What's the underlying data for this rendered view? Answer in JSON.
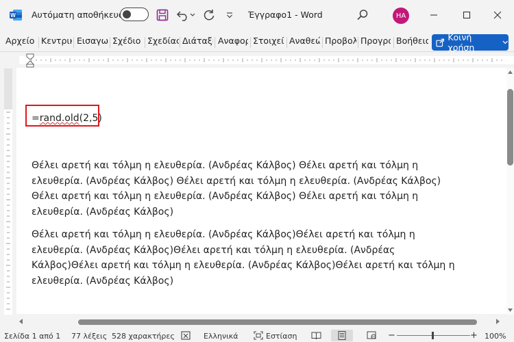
{
  "titlebar": {
    "autosave_label": "Αυτόματη αποθήκευση",
    "doc_title": "Έγγραφο1 - Word",
    "avatar_initials": "HA"
  },
  "ribbon": {
    "tabs": [
      "Αρχείο",
      "Κεντρικ",
      "Εισαγω",
      "Σχέδιο",
      "Σχεδίας",
      "Διάταξη",
      "Αναφορ",
      "Στοιχεί",
      "Αναθεώ",
      "Προβολ",
      "Προγρα",
      "Βοήθεια"
    ],
    "share_label": "Κοινή χρήση"
  },
  "document": {
    "formula": "=rand.old(2,5)",
    "formula_prefix": "=",
    "formula_word": "rand.old",
    "formula_args": "(2,5)",
    "paragraph1": [
      "Θέλει αρετή και τόλμη η ελευθερία. (Ανδρέας Κάλβος) Θέλει αρετή και τόλμη η",
      "ελευθερία. (Ανδρέας Κάλβος) Θέλει αρετή και τόλμη η ελευθερία. (Ανδρέας Κάλβος)",
      "Θέλει αρετή και τόλμη η ελευθερία. (Ανδρέας Κάλβος) Θέλει αρετή και τόλμη η",
      "ελευθερία. (Ανδρέας Κάλβος)"
    ],
    "paragraph2": [
      "Θέλει αρετή και τόλμη η ελευθερία. (Ανδρέας Κάλβος)Θέλει αρετή και τόλμη η",
      "ελευθερία. (Ανδρέας Κάλβος)Θέλει αρετή και τόλμη η ελευθερία. (Ανδρέας",
      "Κάλβος)Θέλει αρετή και τόλμη η ελευθερία. (Ανδρέας Κάλβος)Θέλει αρετή και τόλμη η",
      "ελευθερία. (Ανδρέας Κάλβος)"
    ]
  },
  "statusbar": {
    "page": "Σελίδα 1 από 1",
    "words": "77 λέξεις",
    "characters": "528 χαρακτήρες",
    "language": "Ελληνικά",
    "focus": "Εστίαση",
    "zoom": "100%"
  },
  "colors": {
    "accent": "#1662c4",
    "highlight_box": "#e0161b",
    "avatar": "#c2187a"
  }
}
